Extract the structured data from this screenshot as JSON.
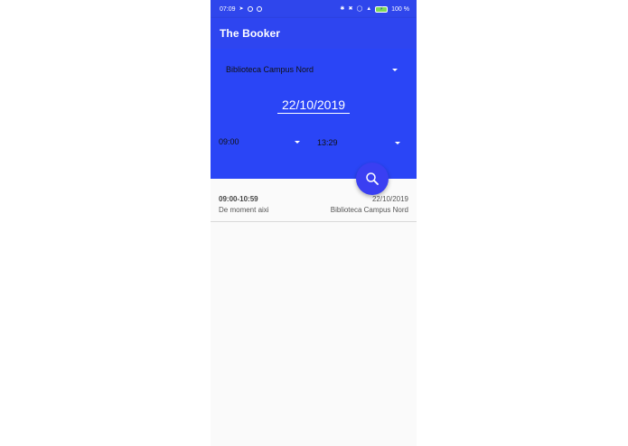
{
  "status_bar": {
    "time": "07:09",
    "battery_text": "100 %",
    "icons": [
      "navigation-icon",
      "telegram-icon",
      "sync-icon",
      "bluetooth-icon",
      "silent-icon",
      "alarm-icon",
      "signal-icon",
      "battery-icon"
    ]
  },
  "app_bar": {
    "title": "The Booker"
  },
  "filters": {
    "library": "Biblioteca Campus Nord",
    "date": "22/10/2019",
    "start_time": "09:00",
    "end_time": "13:29"
  },
  "colors": {
    "primary": "#2a45f6",
    "accent": "#3a3ff2",
    "background": "#fafafa"
  },
  "results": [
    {
      "time_range": "09:00-10:59",
      "description": "De moment aixi",
      "date": "22/10/2019",
      "place": "Biblioteca Campus Nord"
    }
  ]
}
